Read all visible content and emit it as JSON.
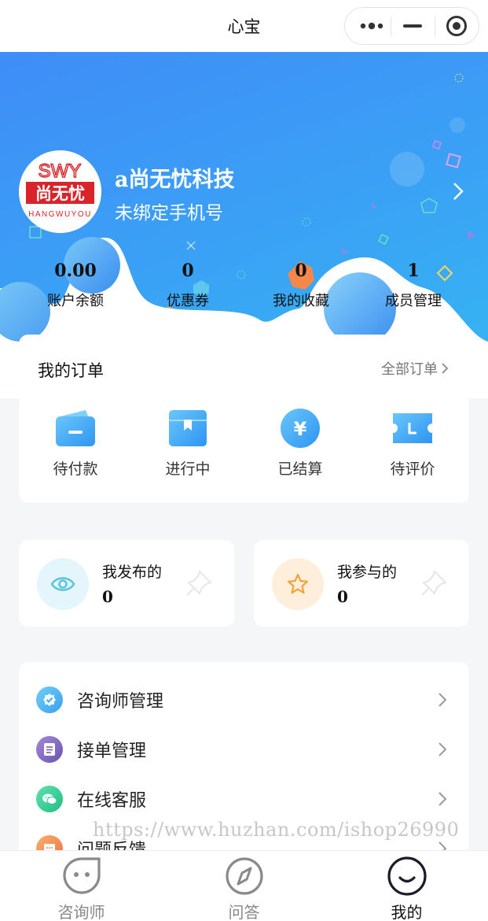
{
  "nav": {
    "title": "心宝"
  },
  "profile": {
    "avatar_logo_text": "SWY尚无忧",
    "name": "a尚无忧科技",
    "phone_status": "未绑定手机号"
  },
  "stats": [
    {
      "value": "0.00",
      "label": "账户余额"
    },
    {
      "value": "0",
      "label": "优惠券"
    },
    {
      "value": "0",
      "label": "我的收藏"
    },
    {
      "value": "1",
      "label": "成员管理"
    }
  ],
  "orders": {
    "title": "我的订单",
    "all_label": "全部订单",
    "items": [
      {
        "label": "待付款",
        "icon": "wallet-icon"
      },
      {
        "label": "进行中",
        "icon": "box-icon"
      },
      {
        "label": "已结算",
        "icon": "yen-icon"
      },
      {
        "label": "待评价",
        "icon": "ticket-icon"
      }
    ]
  },
  "mini": [
    {
      "label": "我发布的",
      "count": "0",
      "icon": "eye-icon",
      "color": "#5bc4dc"
    },
    {
      "label": "我参与的",
      "count": "0",
      "icon": "star-icon",
      "color": "#f3a33a"
    }
  ],
  "menu": [
    {
      "label": "咨询师管理",
      "icon": "verified-icon",
      "color": "#3b9ff0"
    },
    {
      "label": "接单管理",
      "icon": "document-icon",
      "color": "#7a5fb8"
    },
    {
      "label": "在线客服",
      "icon": "wechat-icon",
      "color": "#2ec98f"
    },
    {
      "label": "问题反馈",
      "icon": "message-icon",
      "color": "#f38b5b"
    }
  ],
  "watermark": "https://www.huzhan.com/ishop26990",
  "tabs": [
    {
      "label": "咨询师",
      "icon": "chat-face-icon",
      "active": false
    },
    {
      "label": "问答",
      "icon": "compass-icon",
      "active": false
    },
    {
      "label": "我的",
      "icon": "smile-icon",
      "active": true
    }
  ],
  "colors": {
    "hero_start": "#3f8df7",
    "hero_end": "#35b8f2",
    "accent": "#3b9ff0"
  }
}
